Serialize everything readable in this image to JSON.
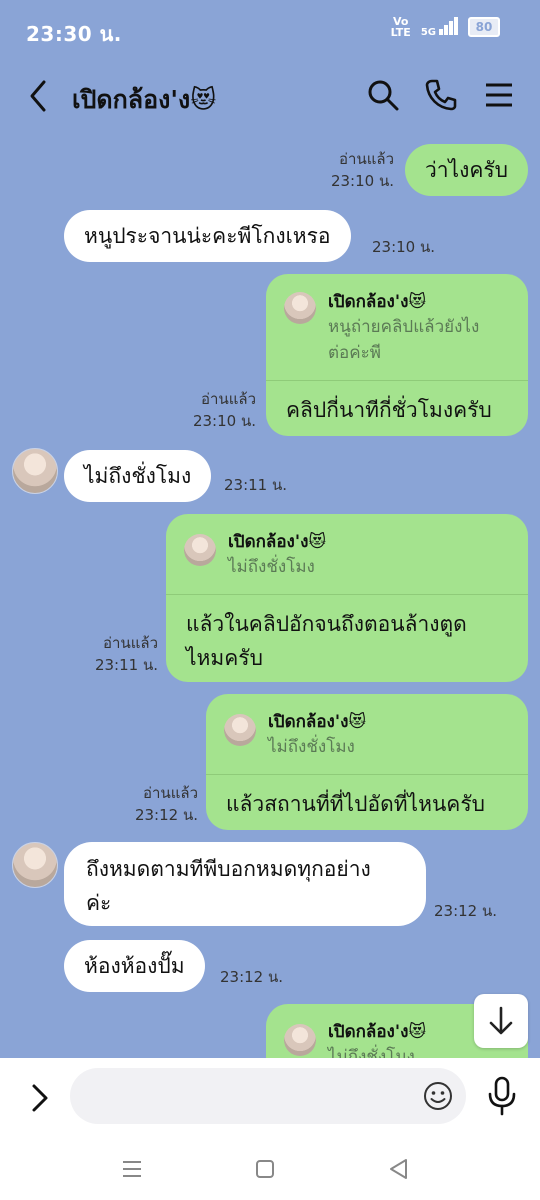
{
  "status_bar": {
    "time": "23:30 น.",
    "volte": [
      "Vo",
      "LTE"
    ],
    "network": "5G",
    "battery": "80"
  },
  "header": {
    "title": "เปิดกล้อง'ง😻"
  },
  "messages": {
    "m1": {
      "text": "ว่าไงครับ",
      "read": "อ่านแล้ว",
      "time": "23:10 น."
    },
    "m2": {
      "text": "หนูประจานน่ะคะพีโกงเหรอ",
      "time": "23:10 น."
    },
    "m3": {
      "quote_name": "เปิดกล้อง'ง😻",
      "quote_text": [
        "หนูถ่ายคลิปแล้วยังไง",
        "ต่อค่ะพี"
      ],
      "text": "คลิปกี่นาทีกี่ชั่วโมงครับ",
      "read": "อ่านแล้ว",
      "time": "23:10 น."
    },
    "m4": {
      "text": "ไม่ถึงชั่งโมง",
      "time": "23:11 น."
    },
    "m5": {
      "quote_name": "เปิดกล้อง'ง😻",
      "quote_text": [
        "ไม่ถึงชั่งโมง"
      ],
      "text_lines": [
        "แล้วในคลิปอักจนถึงตอนล้างตูด",
        "ไหมครับ"
      ],
      "read": "อ่านแล้ว",
      "time": "23:11 น."
    },
    "m6": {
      "quote_name": "เปิดกล้อง'ง😻",
      "quote_text": [
        "ไม่ถึงชั่งโมง"
      ],
      "text": "แล้วสถานที่ที่ไปอัดที่ไหนครับ",
      "read": "อ่านแล้ว",
      "time": "23:12 น."
    },
    "m7": {
      "text_lines": [
        "ถึงหมดตามทีพีบอกหมดทุกอย่าง",
        "ค่ะ"
      ],
      "time": "23:12 น."
    },
    "m8": {
      "text": "ห้องห้องปั๊ม",
      "time": "23:12 น."
    },
    "m9": {
      "quote_name": "เปิดกล้อง'ง😻",
      "quote_text": [
        "ไม่ถึงชั่งโมง"
      ]
    }
  },
  "input": {
    "placeholder": ""
  },
  "colors": {
    "background": "#8aa4d6",
    "my_bubble": "#a4e38e",
    "their_bubble": "#ffffff"
  },
  "icons": [
    "back-icon",
    "search-icon",
    "phone-icon",
    "menu-icon",
    "scroll-down-icon",
    "expand-icon",
    "emoji-icon",
    "mic-icon",
    "recent-apps-icon",
    "home-icon",
    "nav-back-icon"
  ]
}
